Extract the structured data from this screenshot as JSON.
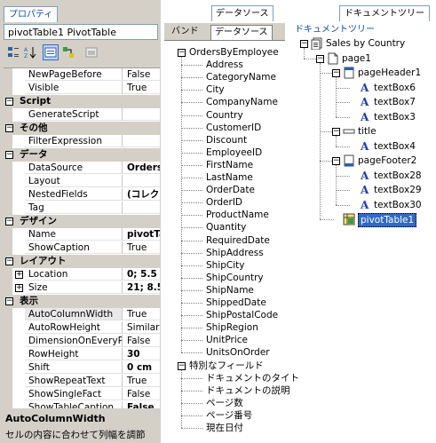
{
  "property_panel": {
    "tab_label": "プロパティ",
    "object_title": "pivotTable1 PivotTable",
    "toolbar": {
      "buttons": [
        "categorized-icon",
        "alphabetical-icon",
        "properties-icon",
        "events-icon",
        "property-pages-icon"
      ]
    },
    "rows": [
      {
        "kind": "prop",
        "name": "NewPageBefore",
        "value": "False"
      },
      {
        "kind": "prop",
        "name": "Visible",
        "value": "True"
      },
      {
        "kind": "cat",
        "name": "Script"
      },
      {
        "kind": "prop",
        "name": "GenerateScript",
        "value": ""
      },
      {
        "kind": "cat",
        "name": "その他"
      },
      {
        "kind": "prop",
        "name": "FilterExpression",
        "value": ""
      },
      {
        "kind": "cat",
        "name": "データ"
      },
      {
        "kind": "prop",
        "name": "DataSource",
        "value": "Orders",
        "bold": true
      },
      {
        "kind": "prop",
        "name": "Layout",
        "value": ""
      },
      {
        "kind": "prop",
        "name": "NestedFields",
        "value": "(コレクシ",
        "bold": true
      },
      {
        "kind": "prop",
        "name": "Tag",
        "value": ""
      },
      {
        "kind": "cat",
        "name": "デザイン"
      },
      {
        "kind": "prop",
        "name": "Name",
        "value": "pivotTa",
        "bold": true
      },
      {
        "kind": "prop",
        "name": "ShowCaption",
        "value": "True"
      },
      {
        "kind": "cat",
        "name": "レイアウト"
      },
      {
        "kind": "prop",
        "name": "Location",
        "value": "0; 5.5 c",
        "bold": true,
        "expand": true
      },
      {
        "kind": "prop",
        "name": "Size",
        "value": "21; 8.5",
        "bold": true,
        "expand": true
      },
      {
        "kind": "cat",
        "name": "表示"
      },
      {
        "kind": "prop",
        "name": "AutoColumnWidth",
        "value": "True",
        "selected": true
      },
      {
        "kind": "prop",
        "name": "AutoRowHeight",
        "value": "Similar"
      },
      {
        "kind": "prop",
        "name": "DimensionOnEveryPa",
        "value": "False"
      },
      {
        "kind": "prop",
        "name": "RowHeight",
        "value": "30",
        "bold": true
      },
      {
        "kind": "prop",
        "name": "Shift",
        "value": "0 cm",
        "bold": true
      },
      {
        "kind": "prop",
        "name": "ShowRepeatText",
        "value": "True"
      },
      {
        "kind": "prop",
        "name": "ShowSingleFact",
        "value": "False"
      },
      {
        "kind": "prop",
        "name": "ShowTableCaption",
        "value": "False",
        "bold": true
      }
    ],
    "description": {
      "title": "AutoColumnWidth",
      "text": "セルの内容に合わせて列幅を調節"
    }
  },
  "datasource_panel": {
    "tab_label": "データソース",
    "subtabs": [
      "バンド",
      "データソース"
    ],
    "root": "OrdersByEmployee",
    "fields": [
      "Address",
      "CategoryName",
      "City",
      "CompanyName",
      "Country",
      "CustomerID",
      "Discount",
      "EmployeeID",
      "FirstName",
      "LastName",
      "OrderDate",
      "OrderID",
      "ProductName",
      "Quantity",
      "RequiredDate",
      "ShipAddress",
      "ShipCity",
      "ShipCountry",
      "ShipName",
      "ShippedDate",
      "ShipPostalCode",
      "ShipRegion",
      "UnitPrice",
      "UnitsOnOrder"
    ],
    "special_root": "特別なフィールド",
    "special_fields": [
      "ドキュメントのタイト",
      "ドキュメントの説明",
      "ページ数",
      "ページ番号",
      "現在日付"
    ]
  },
  "document_panel": {
    "tab_label": "ドキュメントツリー",
    "subtitle": "ドキュメントツリー",
    "nodes": [
      {
        "label": "Sales by Country",
        "level": 0,
        "icon": "report-icon",
        "expanded": true
      },
      {
        "label": "page1",
        "level": 1,
        "icon": "page-icon",
        "expanded": true
      },
      {
        "label": "pageHeader1",
        "level": 2,
        "icon": "page-header-icon",
        "expanded": true
      },
      {
        "label": "textBox6",
        "level": 3,
        "icon": "textbox-icon"
      },
      {
        "label": "textBox7",
        "level": 3,
        "icon": "textbox-icon"
      },
      {
        "label": "textBox3",
        "level": 3,
        "icon": "textbox-icon"
      },
      {
        "label": "title",
        "level": 2,
        "icon": "title-band-icon",
        "expanded": true
      },
      {
        "label": "textBox4",
        "level": 3,
        "icon": "textbox-icon"
      },
      {
        "label": "pageFooter2",
        "level": 2,
        "icon": "page-footer-icon",
        "expanded": true
      },
      {
        "label": "textBox28",
        "level": 3,
        "icon": "textbox-icon"
      },
      {
        "label": "textBox29",
        "level": 3,
        "icon": "textbox-icon"
      },
      {
        "label": "textBox30",
        "level": 3,
        "icon": "textbox-icon"
      },
      {
        "label": "pivotTable1",
        "level": 2,
        "icon": "pivot-table-icon",
        "selected": true
      }
    ]
  }
}
